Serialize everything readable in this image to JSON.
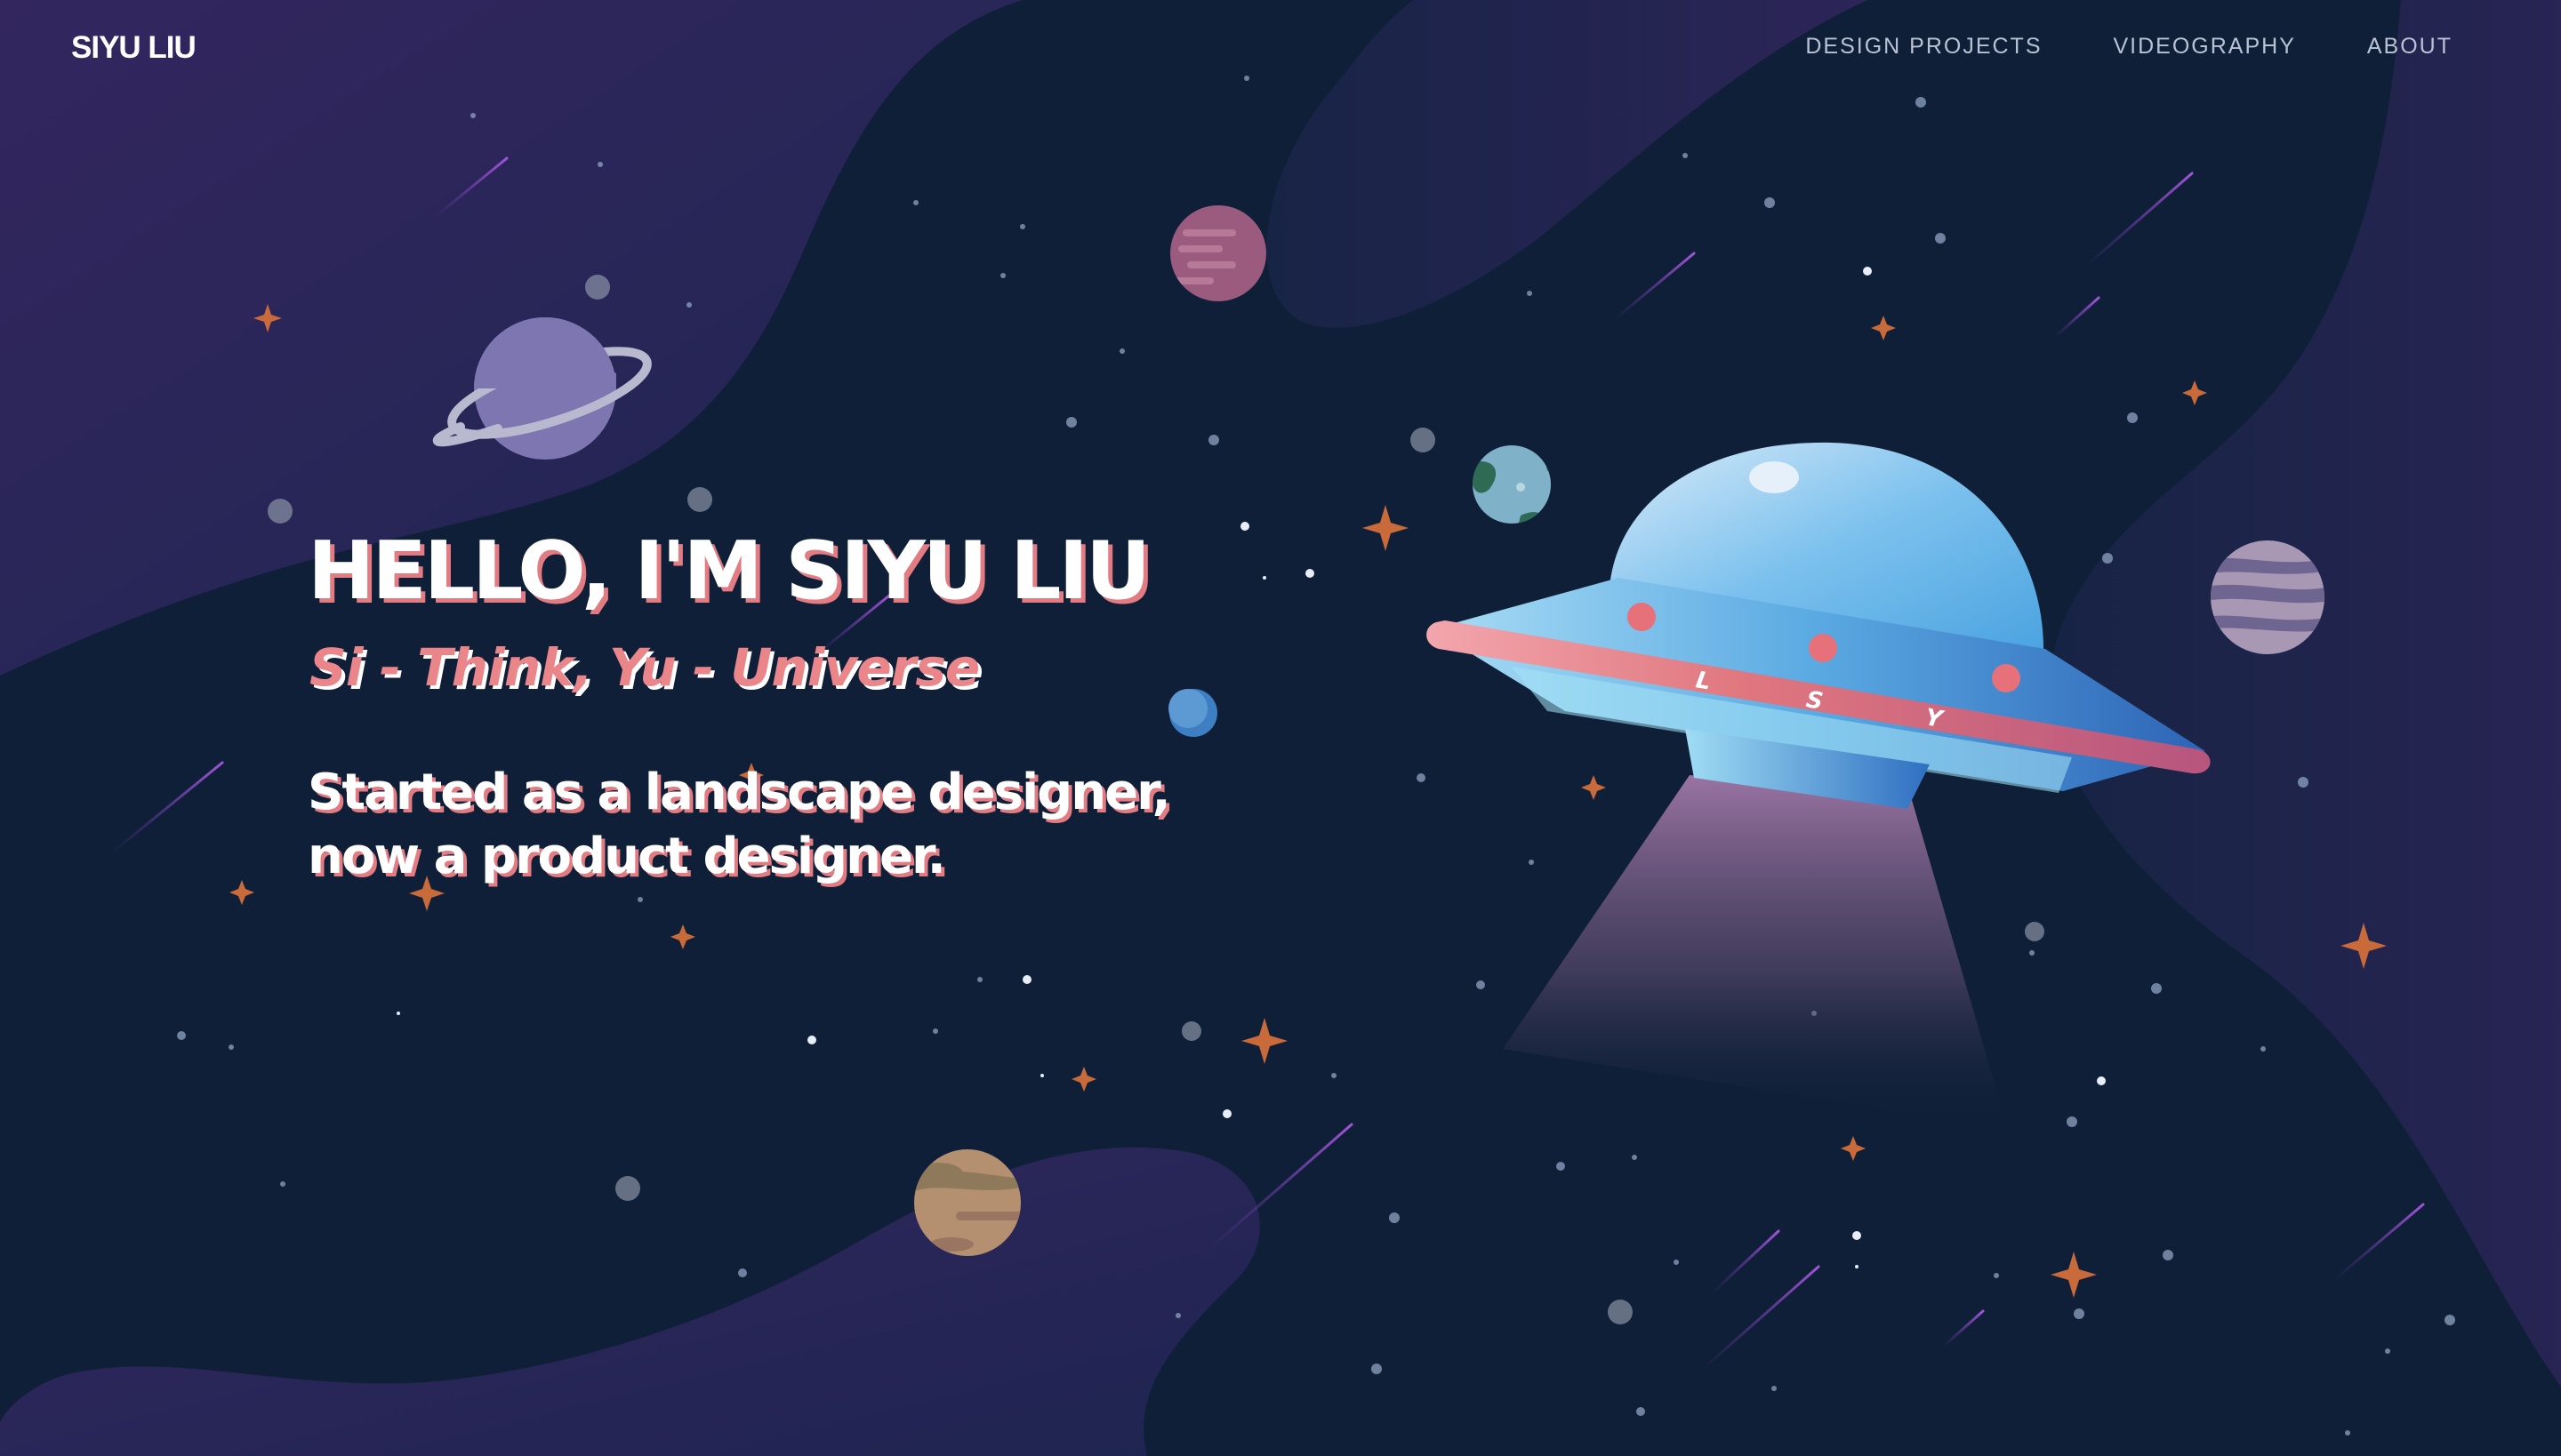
{
  "site": {
    "logo": "SIYU LIU"
  },
  "nav": {
    "items": [
      {
        "label": "DESIGN PROJECTS"
      },
      {
        "label": "VIDEOGRAPHY"
      },
      {
        "label": "ABOUT"
      }
    ]
  },
  "hero": {
    "title": "HELLO, I'M SIYU LIU",
    "tagline": "Si - Think, Yu - Universe",
    "description_lines": [
      "Started as a landscape designer,",
      "now a product designer."
    ]
  },
  "ufo": {
    "letters": [
      "L",
      "S",
      "Y"
    ]
  },
  "colors": {
    "background": "#0f1f38",
    "blob_purple": "#2c2558",
    "accent_pink": "#e37b83",
    "star_orange": "#c96a3a",
    "ufo_blue": "#5aaee6"
  },
  "icons": {
    "illustration": "ufo-icon",
    "planets": [
      "saturn-planet-icon",
      "pink-planet-icon",
      "earth-planet-icon",
      "blue-moon-icon",
      "striped-planet-icon",
      "tan-planet-icon"
    ]
  }
}
